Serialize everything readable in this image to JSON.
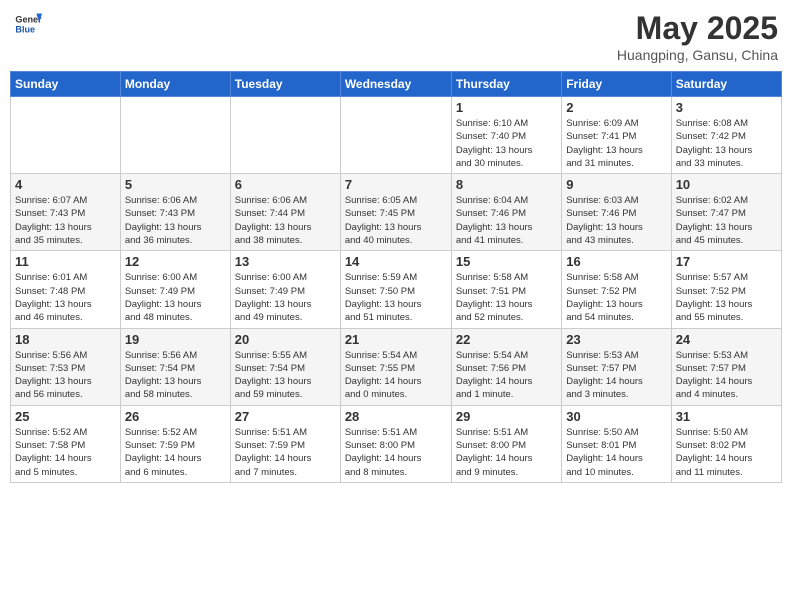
{
  "header": {
    "logo_general": "General",
    "logo_blue": "Blue",
    "title": "May 2025",
    "location": "Huangping, Gansu, China"
  },
  "weekdays": [
    "Sunday",
    "Monday",
    "Tuesday",
    "Wednesday",
    "Thursday",
    "Friday",
    "Saturday"
  ],
  "weeks": [
    [
      {
        "day": "",
        "info": ""
      },
      {
        "day": "",
        "info": ""
      },
      {
        "day": "",
        "info": ""
      },
      {
        "day": "",
        "info": ""
      },
      {
        "day": "1",
        "info": "Sunrise: 6:10 AM\nSunset: 7:40 PM\nDaylight: 13 hours\nand 30 minutes."
      },
      {
        "day": "2",
        "info": "Sunrise: 6:09 AM\nSunset: 7:41 PM\nDaylight: 13 hours\nand 31 minutes."
      },
      {
        "day": "3",
        "info": "Sunrise: 6:08 AM\nSunset: 7:42 PM\nDaylight: 13 hours\nand 33 minutes."
      }
    ],
    [
      {
        "day": "4",
        "info": "Sunrise: 6:07 AM\nSunset: 7:43 PM\nDaylight: 13 hours\nand 35 minutes."
      },
      {
        "day": "5",
        "info": "Sunrise: 6:06 AM\nSunset: 7:43 PM\nDaylight: 13 hours\nand 36 minutes."
      },
      {
        "day": "6",
        "info": "Sunrise: 6:06 AM\nSunset: 7:44 PM\nDaylight: 13 hours\nand 38 minutes."
      },
      {
        "day": "7",
        "info": "Sunrise: 6:05 AM\nSunset: 7:45 PM\nDaylight: 13 hours\nand 40 minutes."
      },
      {
        "day": "8",
        "info": "Sunrise: 6:04 AM\nSunset: 7:46 PM\nDaylight: 13 hours\nand 41 minutes."
      },
      {
        "day": "9",
        "info": "Sunrise: 6:03 AM\nSunset: 7:46 PM\nDaylight: 13 hours\nand 43 minutes."
      },
      {
        "day": "10",
        "info": "Sunrise: 6:02 AM\nSunset: 7:47 PM\nDaylight: 13 hours\nand 45 minutes."
      }
    ],
    [
      {
        "day": "11",
        "info": "Sunrise: 6:01 AM\nSunset: 7:48 PM\nDaylight: 13 hours\nand 46 minutes."
      },
      {
        "day": "12",
        "info": "Sunrise: 6:00 AM\nSunset: 7:49 PM\nDaylight: 13 hours\nand 48 minutes."
      },
      {
        "day": "13",
        "info": "Sunrise: 6:00 AM\nSunset: 7:49 PM\nDaylight: 13 hours\nand 49 minutes."
      },
      {
        "day": "14",
        "info": "Sunrise: 5:59 AM\nSunset: 7:50 PM\nDaylight: 13 hours\nand 51 minutes."
      },
      {
        "day": "15",
        "info": "Sunrise: 5:58 AM\nSunset: 7:51 PM\nDaylight: 13 hours\nand 52 minutes."
      },
      {
        "day": "16",
        "info": "Sunrise: 5:58 AM\nSunset: 7:52 PM\nDaylight: 13 hours\nand 54 minutes."
      },
      {
        "day": "17",
        "info": "Sunrise: 5:57 AM\nSunset: 7:52 PM\nDaylight: 13 hours\nand 55 minutes."
      }
    ],
    [
      {
        "day": "18",
        "info": "Sunrise: 5:56 AM\nSunset: 7:53 PM\nDaylight: 13 hours\nand 56 minutes."
      },
      {
        "day": "19",
        "info": "Sunrise: 5:56 AM\nSunset: 7:54 PM\nDaylight: 13 hours\nand 58 minutes."
      },
      {
        "day": "20",
        "info": "Sunrise: 5:55 AM\nSunset: 7:54 PM\nDaylight: 13 hours\nand 59 minutes."
      },
      {
        "day": "21",
        "info": "Sunrise: 5:54 AM\nSunset: 7:55 PM\nDaylight: 14 hours\nand 0 minutes."
      },
      {
        "day": "22",
        "info": "Sunrise: 5:54 AM\nSunset: 7:56 PM\nDaylight: 14 hours\nand 1 minute."
      },
      {
        "day": "23",
        "info": "Sunrise: 5:53 AM\nSunset: 7:57 PM\nDaylight: 14 hours\nand 3 minutes."
      },
      {
        "day": "24",
        "info": "Sunrise: 5:53 AM\nSunset: 7:57 PM\nDaylight: 14 hours\nand 4 minutes."
      }
    ],
    [
      {
        "day": "25",
        "info": "Sunrise: 5:52 AM\nSunset: 7:58 PM\nDaylight: 14 hours\nand 5 minutes."
      },
      {
        "day": "26",
        "info": "Sunrise: 5:52 AM\nSunset: 7:59 PM\nDaylight: 14 hours\nand 6 minutes."
      },
      {
        "day": "27",
        "info": "Sunrise: 5:51 AM\nSunset: 7:59 PM\nDaylight: 14 hours\nand 7 minutes."
      },
      {
        "day": "28",
        "info": "Sunrise: 5:51 AM\nSunset: 8:00 PM\nDaylight: 14 hours\nand 8 minutes."
      },
      {
        "day": "29",
        "info": "Sunrise: 5:51 AM\nSunset: 8:00 PM\nDaylight: 14 hours\nand 9 minutes."
      },
      {
        "day": "30",
        "info": "Sunrise: 5:50 AM\nSunset: 8:01 PM\nDaylight: 14 hours\nand 10 minutes."
      },
      {
        "day": "31",
        "info": "Sunrise: 5:50 AM\nSunset: 8:02 PM\nDaylight: 14 hours\nand 11 minutes."
      }
    ]
  ]
}
